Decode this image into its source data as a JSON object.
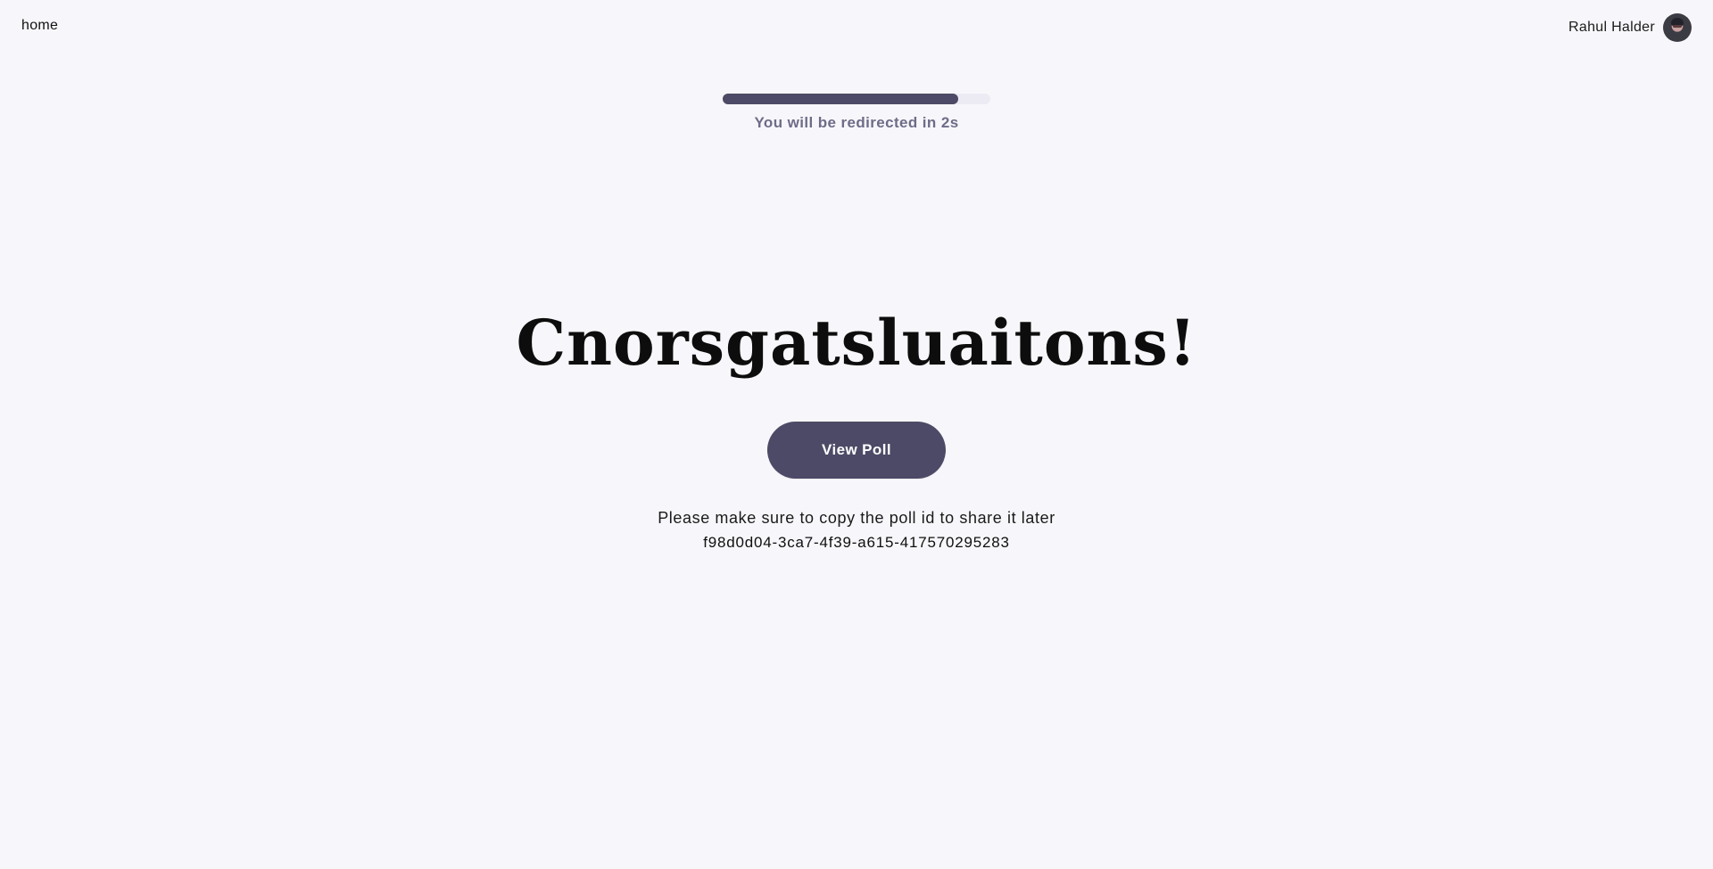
{
  "nav": {
    "home_label": "home",
    "user_name": "Rahul Halder"
  },
  "redirect": {
    "progress": 0.88,
    "message": "You will be redirected in 2s"
  },
  "main": {
    "headline": "Cnorsgatsluaitons!",
    "button_label": "View Poll",
    "info_text": "Please make sure to copy the poll id to share it later",
    "poll_id": "f98d0d04-3ca7-4f39-a615-417570295283"
  },
  "colors": {
    "background": "#f7f7fb",
    "accent": "#4c4a66",
    "progress_track": "#ecebf4",
    "muted_text": "#6e6c88"
  },
  "icons": {
    "avatar": "user-avatar-icon"
  }
}
